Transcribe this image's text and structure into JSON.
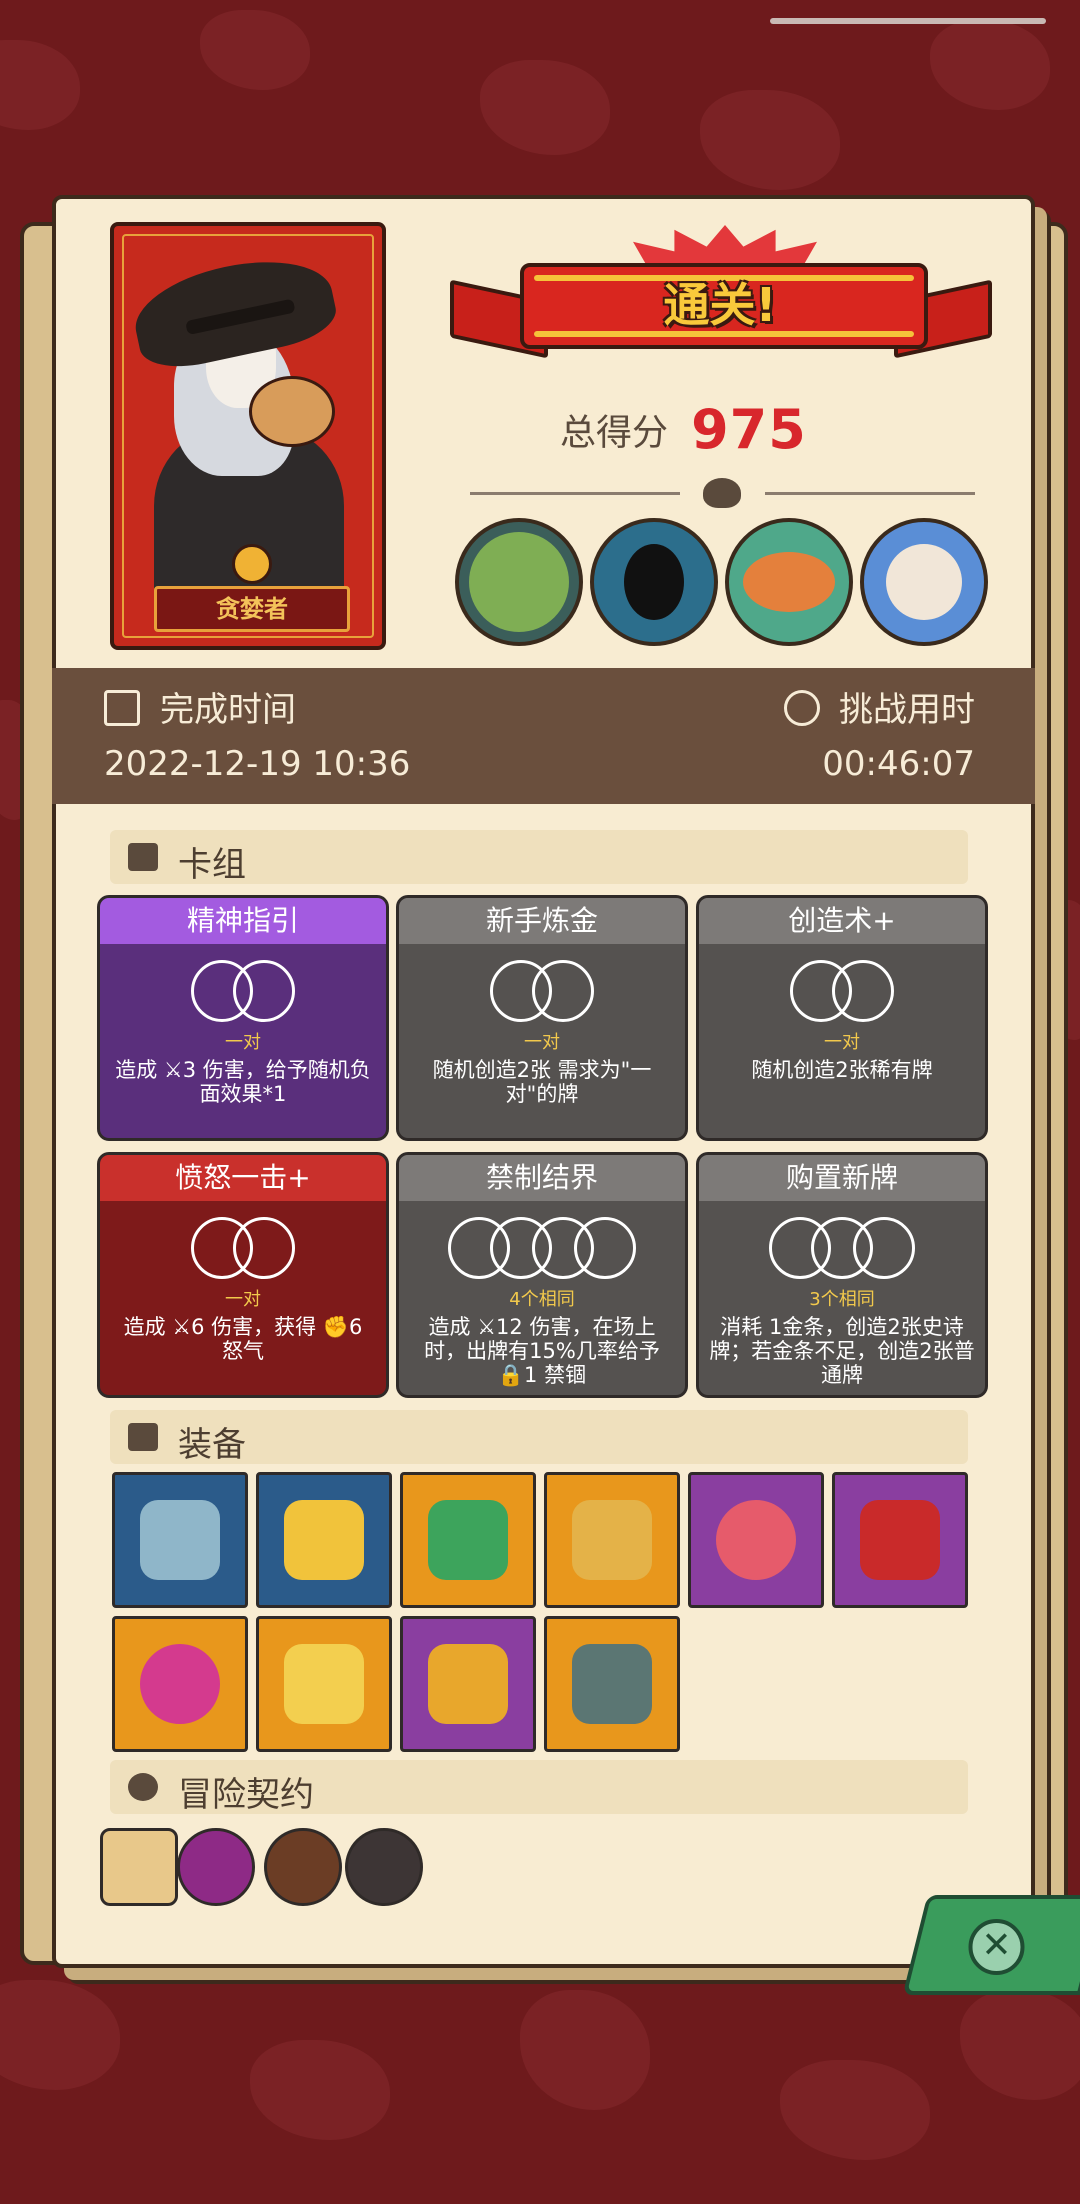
{
  "result": {
    "title": "通关!",
    "score_label": "总得分",
    "score_value": "975",
    "character_name": "贪婪者"
  },
  "info": {
    "finish_label": "完成时间",
    "finish_value": "2022-12-19 10:36",
    "challenge_label": "挑战用时",
    "challenge_value": "00:46:07"
  },
  "sections": {
    "deck": "卡组",
    "equipment": "装备",
    "contracts": "冒险契约"
  },
  "cards": [
    {
      "name": "精神指引",
      "sub": "一对",
      "desc": "造成 ⚔3 伤害，给予随机负面效果*1",
      "color": "purple"
    },
    {
      "name": "新手炼金",
      "sub": "一对",
      "desc": "随机创造2张 需求为\"一对\"的牌",
      "color": "gray"
    },
    {
      "name": "创造术+",
      "sub": "一对",
      "desc": "随机创造2张稀有牌",
      "color": "gray"
    },
    {
      "name": "愤怒一击+",
      "sub": "一对",
      "desc": "造成 ⚔6 伤害，获得 ✊6 怒气",
      "color": "red"
    },
    {
      "name": "禁制结界",
      "sub": "4个相同",
      "desc": "造成 ⚔12 伤害，在场上时，出牌有15%几率给予 🔒1 禁锢",
      "color": "gray"
    },
    {
      "name": "购置新牌",
      "sub": "3个相同",
      "desc": "消耗 1金条，创造2张史诗牌；若金条不足，创造2张普通牌",
      "color": "gray"
    }
  ],
  "equipment": [
    {
      "icon": "scythe-icon",
      "bg": "blue"
    },
    {
      "icon": "gold-helmet-icon",
      "bg": "blue"
    },
    {
      "icon": "green-rune-stone-icon",
      "bg": "orange"
    },
    {
      "icon": "gold-amulet-icon",
      "bg": "orange"
    },
    {
      "icon": "rainbow-swirl-icon",
      "bg": "purple"
    },
    {
      "icon": "red-bracelet-icon",
      "bg": "purple"
    },
    {
      "icon": "pink-orb-icon",
      "bg": "orange"
    },
    {
      "icon": "gold-crown-icon",
      "bg": "orange"
    },
    {
      "icon": "gold-bowl-icon",
      "bg": "purple"
    },
    {
      "icon": "iron-helmet-icon",
      "bg": "orange"
    }
  ],
  "colors": {
    "accent_red": "#d8272c",
    "title_gold": "#f9c93b",
    "panel": "#f8ecd2",
    "info_bar": "#6a4f3d"
  }
}
